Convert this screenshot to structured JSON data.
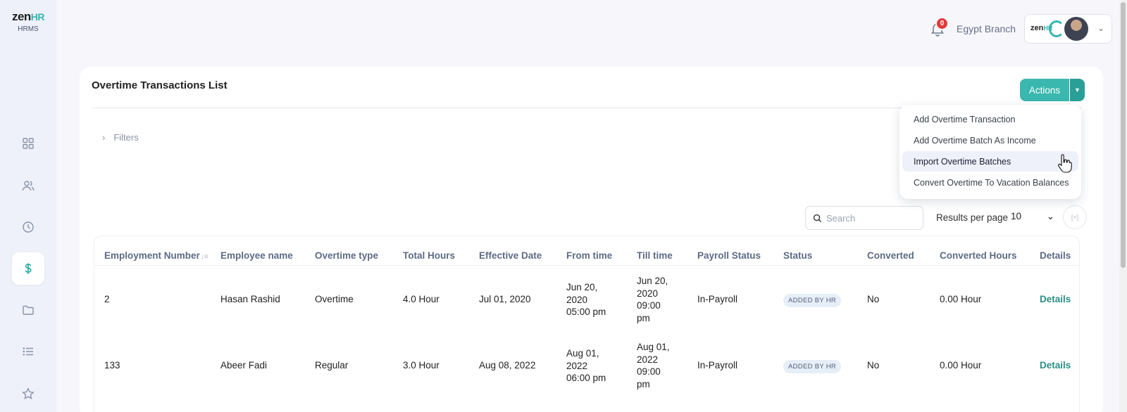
{
  "brand": {
    "logo_main": "zen",
    "logo_accent": "HR",
    "product": "HRMS"
  },
  "sidebar": {
    "items": [
      {
        "icon": "dashboard-grid-icon"
      },
      {
        "icon": "people-icon"
      },
      {
        "icon": "clock-icon"
      },
      {
        "icon": "dollar-icon",
        "active": true
      },
      {
        "icon": "folder-icon"
      },
      {
        "icon": "list-icon"
      },
      {
        "icon": "star-icon"
      }
    ]
  },
  "header": {
    "notification_count": "0",
    "branch": "Egypt Branch",
    "company_logo_main": "zen",
    "company_logo_accent": "HR"
  },
  "page": {
    "title": "Overtime Transactions List",
    "actions_label": "Actions",
    "filters_label": "Filters",
    "search_placeholder": "Search",
    "results_per_page_label": "Results per page",
    "results_per_page_value": "10"
  },
  "actions_menu": {
    "items": [
      "Add Overtime Transaction",
      "Add Overtime Batch As Income",
      "Import Overtime Batches",
      "Convert Overtime To Vacation Balances"
    ],
    "hovered_index": 2
  },
  "table": {
    "columns": [
      "Employment Number",
      "Employee name",
      "Overtime type",
      "Total Hours",
      "Effective Date",
      "From time",
      "Till time",
      "Payroll Status",
      "Status",
      "Converted",
      "Converted Hours",
      "Details"
    ],
    "rows": [
      {
        "employment_number": "2",
        "employee_name": "Hasan Rashid",
        "overtime_type": "Overtime",
        "total_hours": "4.0 Hour",
        "effective_date": "Jul 01, 2020",
        "from_time": [
          "Jun 20,",
          "2020",
          "05:00 pm"
        ],
        "till_time": [
          "Jun 20,",
          "2020",
          "09:00",
          "pm"
        ],
        "payroll_status": "In-Payroll",
        "status": "ADDED BY HR",
        "converted": "No",
        "converted_hours": "0.00 Hour",
        "details": "Details"
      },
      {
        "employment_number": "133",
        "employee_name": "Abeer Fadi",
        "overtime_type": "Regular",
        "total_hours": "3.0 Hour",
        "effective_date": "Aug 08, 2022",
        "from_time": [
          "Aug 01,",
          "2022",
          "06:00 pm"
        ],
        "till_time": [
          "Aug 01,",
          "2022",
          "09:00",
          "pm"
        ],
        "payroll_status": "In-Payroll",
        "status": "ADDED BY HR",
        "converted": "No",
        "converted_hours": "0.00 Hour",
        "details": "Details"
      }
    ]
  },
  "colors": {
    "accent": "#3ab7ae",
    "accent_dark": "#2a9f97",
    "badge": "#e13b3b",
    "link": "#2a8f87"
  }
}
